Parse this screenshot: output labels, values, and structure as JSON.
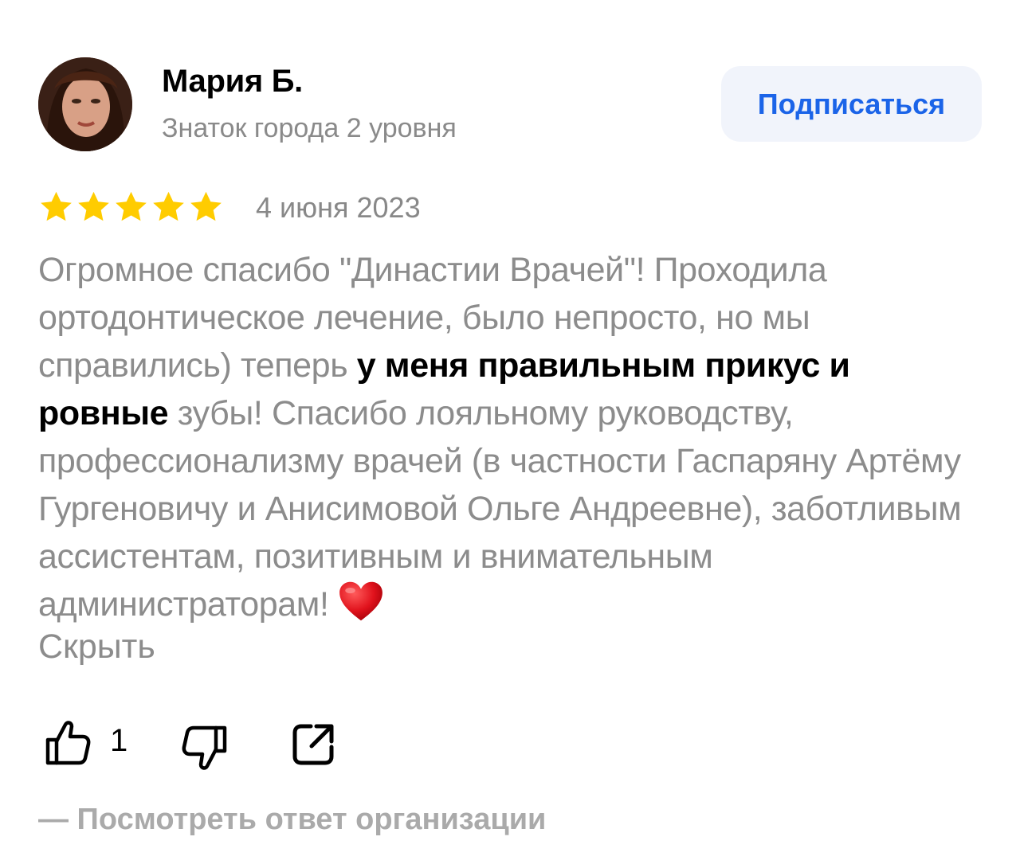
{
  "author": {
    "name": "Мария Б.",
    "level": "Знаток города 2 уровня",
    "avatar": "user-avatar-photo"
  },
  "subscribe": {
    "label": "Подписаться",
    "color": "#1b64e8"
  },
  "review": {
    "rating": 5,
    "rating_max": 5,
    "star_color": "#ffcc00",
    "date": "4 июня 2023",
    "text_part1": "Огромное спасибо \"Династии Врачей\"! Проходила ортодонтическое лечение, было непросто, но мы справились) теперь ",
    "text_bold": "у меня правильным прикус и ровные",
    "text_part2": " зубы! Спасибо лояльному руководству, профессионализму врачей (в частности Гаспаряну Артёму Гургеновичу и Анисимовой Ольге Андреевне), заботливым ассистентам, позитивным и внимательным администраторам! ",
    "emoji": "heart-icon",
    "hide_label": "Скрыть"
  },
  "actions": {
    "like_count": "1",
    "like_icon": "thumbs-up-icon",
    "dislike_icon": "thumbs-down-icon",
    "share_icon": "share-icon"
  },
  "org_reply": {
    "label": "— Посмотреть ответ организации"
  }
}
